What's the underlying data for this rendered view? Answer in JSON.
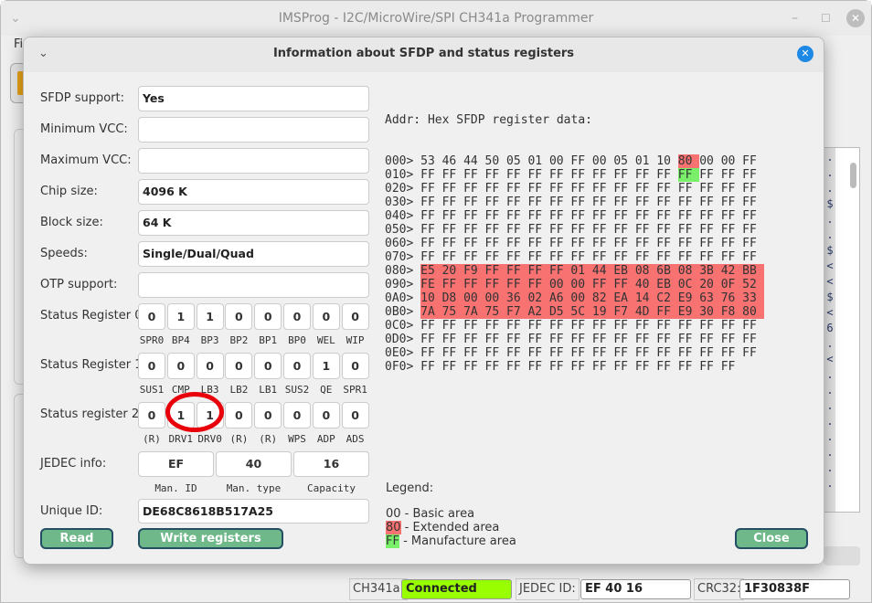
{
  "main_window": {
    "title": "IMSProg - I2C/MicroWire/SPI CH341a Programmer",
    "menu_partial": "Fi",
    "right_panel_chars": [
      ".",
      ".",
      ".",
      "$",
      ".",
      ".",
      "$",
      "<",
      "<",
      "$",
      "<",
      "6",
      ".",
      "<",
      ".",
      ".",
      ".",
      ".",
      ".",
      ".",
      ".",
      "."
    ]
  },
  "statusbar": {
    "ch341a_label": "CH341a:",
    "ch341a_value": "Connected",
    "ch341a_color": "#99ff00",
    "jedec_label": "JEDEC ID:",
    "jedec_value": "EF 40 16",
    "crc_label": "CRC32:",
    "crc_value": "1F30838F"
  },
  "dialog": {
    "title": "Information about SFDP and status registers",
    "fields": [
      {
        "label": "SFDP support:",
        "value": "Yes"
      },
      {
        "label": "Minimum VCC:",
        "value": ""
      },
      {
        "label": "Maximum VCC:",
        "value": ""
      },
      {
        "label": "Chip size:",
        "value": "4096 K"
      },
      {
        "label": "Block size:",
        "value": "64 K"
      },
      {
        "label": "Speeds:",
        "value": "Single/Dual/Quad"
      },
      {
        "label": "OTP support:",
        "value": ""
      }
    ],
    "status_registers": [
      {
        "label": "Status Register 0",
        "bits": [
          "0",
          "1",
          "1",
          "0",
          "0",
          "0",
          "0",
          "0"
        ],
        "names": [
          "SPR0",
          "BP4",
          "BP3",
          "BP2",
          "BP1",
          "BP0",
          "WEL",
          "WIP"
        ]
      },
      {
        "label": "Status Register 1",
        "bits": [
          "0",
          "0",
          "0",
          "0",
          "0",
          "0",
          "1",
          "0"
        ],
        "names": [
          "SUS1",
          "CMP",
          "LB3",
          "LB2",
          "LB1",
          "SUS2",
          "QE",
          "SPR1"
        ]
      },
      {
        "label": "Status register 2",
        "bits": [
          "0",
          "1",
          "1",
          "0",
          "0",
          "0",
          "0",
          "0"
        ],
        "names": [
          "(R)",
          "DRV1",
          "DRV0",
          "(R)",
          "(R)",
          "WPS",
          "ADP",
          "ADS"
        ]
      }
    ],
    "jedec": {
      "label": "JEDEC info:",
      "values": [
        "EF",
        "40",
        "16"
      ],
      "names": [
        "Man. ID",
        "Man. type",
        "Capacity"
      ]
    },
    "unique_id": {
      "label": "Unique ID:",
      "value": "DE68C8618B517A25"
    },
    "buttons": {
      "read": "Read",
      "write": "Write registers",
      "close": "Close"
    },
    "hex": {
      "header_addr": "Addr:",
      "header_title": "Hex SFDP register data:",
      "rows": [
        {
          "addr": "000>",
          "bytes": "53 46 44 50 05 01 00 FF 00 05 01 10 80 00 00 FF",
          "ext": [
            12
          ],
          "mfr": []
        },
        {
          "addr": "010>",
          "bytes": "FF FF FF FF FF FF FF FF FF FF FF FF FF FF FF FF",
          "ext": [],
          "mfr": [
            12
          ]
        },
        {
          "addr": "020>",
          "bytes": "FF FF FF FF FF FF FF FF FF FF FF FF FF FF FF FF",
          "ext": [],
          "mfr": []
        },
        {
          "addr": "030>",
          "bytes": "FF FF FF FF FF FF FF FF FF FF FF FF FF FF FF FF",
          "ext": [],
          "mfr": []
        },
        {
          "addr": "040>",
          "bytes": "FF FF FF FF FF FF FF FF FF FF FF FF FF FF FF FF",
          "ext": [],
          "mfr": []
        },
        {
          "addr": "050>",
          "bytes": "FF FF FF FF FF FF FF FF FF FF FF FF FF FF FF FF",
          "ext": [],
          "mfr": []
        },
        {
          "addr": "060>",
          "bytes": "FF FF FF FF FF FF FF FF FF FF FF FF FF FF FF FF",
          "ext": [],
          "mfr": []
        },
        {
          "addr": "070>",
          "bytes": "FF FF FF FF FF FF FF FF FF FF FF FF FF FF FF FF",
          "ext": [],
          "mfr": []
        },
        {
          "addr": "080>",
          "bytes": "E5 20 F9 FF FF FF FF 01 44 EB 08 6B 08 3B 42 BB",
          "ext": "all",
          "mfr": []
        },
        {
          "addr": "090>",
          "bytes": "FE FF FF FF FF FF 00 00 FF FF 40 EB 0C 20 0F 52",
          "ext": "all",
          "mfr": []
        },
        {
          "addr": "0A0>",
          "bytes": "10 D8 00 00 36 02 A6 00 82 EA 14 C2 E9 63 76 33",
          "ext": "all",
          "mfr": []
        },
        {
          "addr": "0B0>",
          "bytes": "7A 75 7A 75 F7 A2 D5 5C 19 F7 4D FF E9 30 F8 80",
          "ext": "all",
          "mfr": []
        },
        {
          "addr": "0C0>",
          "bytes": "FF FF FF FF FF FF FF FF FF FF FF FF FF FF FF FF",
          "ext": [],
          "mfr": []
        },
        {
          "addr": "0D0>",
          "bytes": "FF FF FF FF FF FF FF FF FF FF FF FF FF FF FF FF",
          "ext": [],
          "mfr": []
        },
        {
          "addr": "0E0>",
          "bytes": "FF FF FF FF FF FF FF FF FF FF FF FF FF FF FF FF",
          "ext": [],
          "mfr": []
        },
        {
          "addr": "0F0>",
          "bytes": "FF FF FF FF FF FF FF FF FF FF FF FF FF FF FF",
          "ext": [],
          "mfr": []
        }
      ]
    },
    "legend": {
      "title": "Legend:",
      "items": [
        {
          "code": "00",
          "text": " - Basic area"
        },
        {
          "code": "80",
          "text": " - Extended area"
        },
        {
          "code": "FF",
          "text": " - Manufacture area"
        }
      ],
      "ext_color": "#f87272",
      "mfr_color": "#7aef6a"
    }
  }
}
